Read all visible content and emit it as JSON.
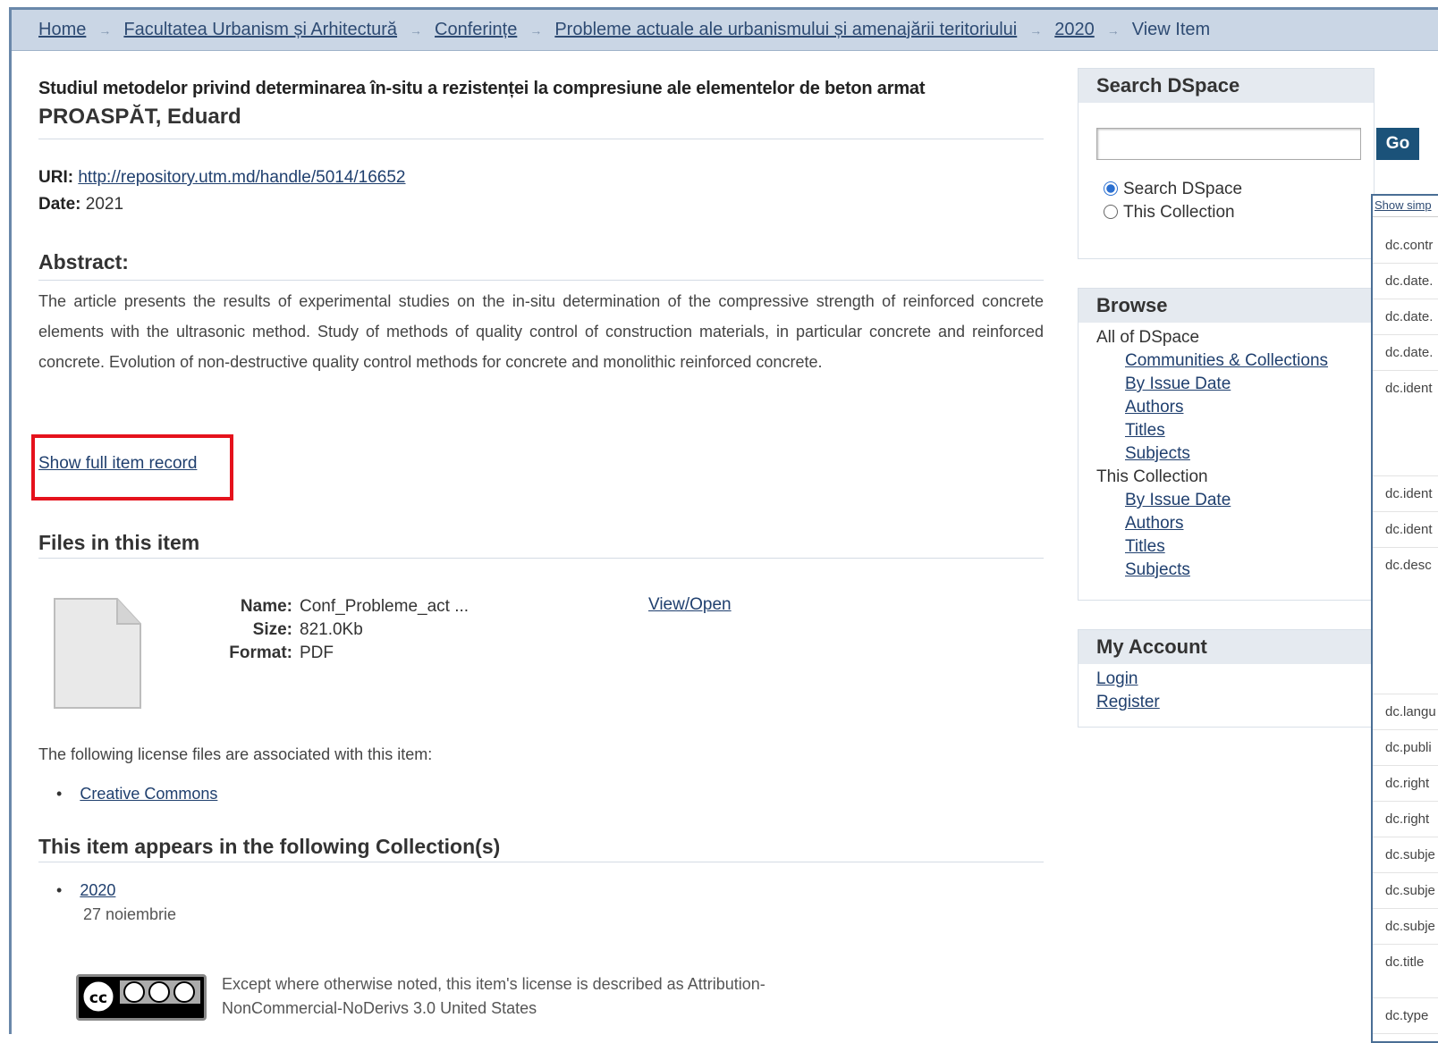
{
  "breadcrumb": [
    "Home",
    "Facultatea Urbanism și Arhitectură",
    "Conferințe",
    "Probleme actuale ale urbanismului și amenajării teritoriului",
    "2020",
    "View Item"
  ],
  "item": {
    "title": "Studiul metodelor privind determinarea în-situ a rezistenței la compresiune ale elementelor de beton armat",
    "author": "PROASPĂT, Eduard",
    "uri_label": "URI:",
    "uri": "http://repository.utm.md/handle/5014/16652",
    "date_label": "Date:",
    "date": "2021",
    "abstract_heading": "Abstract:",
    "abstract": "The article presents the results of experimental studies on the in-situ determination of the compressive strength of reinforced concrete elements with the ultrasonic method. Study of methods of quality control of construction materials, in particular concrete and reinforced concrete. Evolution of non-destructive quality control methods for concrete and monolithic reinforced concrete.",
    "show_full": "Show full item record"
  },
  "files": {
    "heading": "Files in this item",
    "name_label": "Name:",
    "name": "Conf_Probleme_act ...",
    "size_label": "Size:",
    "size": "821.0Kb",
    "format_label": "Format:",
    "format": "PDF",
    "view": "View/Open",
    "license_note": "The following license files are associated with this item:",
    "license_link": "Creative Commons"
  },
  "collections": {
    "heading": "This item appears in the following Collection(s)",
    "link": "2020",
    "desc": "27 noiembrie"
  },
  "cc": {
    "line1": "Except where otherwise noted, this item's license is described as Attribution-",
    "line2": "NonCommercial-NoDerivs 3.0 United States"
  },
  "search": {
    "heading": "Search DSpace",
    "go": "Go",
    "opt1": "Search DSpace",
    "opt2": "This Collection"
  },
  "browse": {
    "heading": "Browse",
    "all": "All of DSpace",
    "all_items": [
      "Communities & Collections",
      "By Issue Date",
      "Authors",
      "Titles",
      "Subjects"
    ],
    "coll": "This Collection",
    "coll_items": [
      "By Issue Date",
      "Authors",
      "Titles",
      "Subjects"
    ]
  },
  "account": {
    "heading": "My Account",
    "login": "Login",
    "register": "Register"
  },
  "popup": {
    "top": "Show simp",
    "rows": [
      "dc.contr",
      "dc.date.",
      "dc.date.",
      "dc.date.",
      "dc.ident",
      "dc.ident",
      "dc.ident",
      "dc.desc",
      "dc.langu",
      "dc.publi",
      "dc.right",
      "dc.right",
      "dc.subje",
      "dc.subje",
      "dc.subje",
      "dc.title",
      "dc.type"
    ]
  },
  "colors": {
    "highlight_box": "#e5121c",
    "breadcrumb_bg": "#cad6e5",
    "go_button": "#1b5279"
  }
}
